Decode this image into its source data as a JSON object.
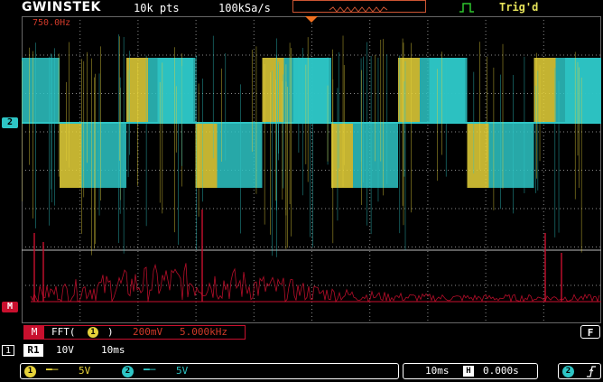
{
  "header": {
    "brand": "GWINSTEK",
    "record_length": "10k pts",
    "sample_rate": "100kSa/s",
    "trigger_status": "Trig'd",
    "trigger_icon": "rising-edge-trigger-icon"
  },
  "display": {
    "fft_freq_readout": "750.0Hz",
    "channel2_marker": "2",
    "math_marker": "M"
  },
  "fft_bar": {
    "math_label": "M",
    "function": "FFT(",
    "source": "1",
    "close": ")",
    "scale": "200mV",
    "center_freq": "5.000kHz"
  },
  "function_key": "F",
  "ref": {
    "index": "1",
    "label": "R1",
    "volts_div": "10V",
    "time_div": "10ms"
  },
  "status": {
    "ch1": {
      "label": "1",
      "coupling": "DC",
      "volts_div": "5V"
    },
    "ch2": {
      "label": "2",
      "coupling": "DC",
      "volts_div": "5V"
    },
    "time_div": "10ms",
    "h_label": "H",
    "h_position": "0.000s",
    "trig_source": "2",
    "trig_slope": "rising"
  },
  "colors": {
    "ch1": "#e6d23a",
    "ch2": "#2ec5c5",
    "math": "#c8102e",
    "grid": "#8a8a8a"
  }
}
